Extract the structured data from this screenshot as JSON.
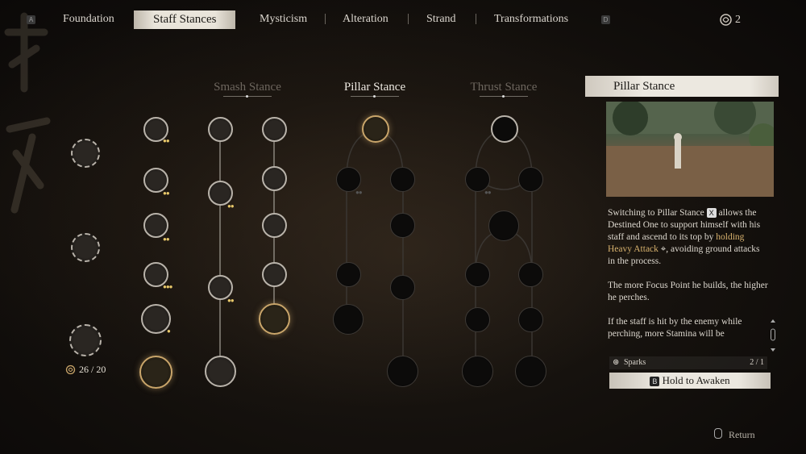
{
  "nav": {
    "left_key": "A",
    "right_key": "D",
    "tabs": [
      "Foundation",
      "Staff Stances",
      "Mysticism",
      "Alteration",
      "Strand",
      "Transformations"
    ],
    "active_tab": "Staff Stances",
    "spark_count": "2"
  },
  "left_column": {
    "progress": "26 / 20"
  },
  "stances": {
    "smash": "Smash Stance",
    "pillar": "Pillar Stance",
    "thrust": "Thrust Stance",
    "selected": "Pillar Stance"
  },
  "panel": {
    "title": "Pillar Stance",
    "desc_1_a": "Switching to Pillar Stance",
    "desc_1_key": "X",
    "desc_1_b": "allows the Destined One to support himself with his staff and ascend to its top by",
    "desc_1_hl": "holding Heavy Attack",
    "desc_1_c": ", avoiding ground attacks in the process.",
    "desc_2": "The more Focus Point he builds, the higher he perches.",
    "desc_3": "If the staff is hit by the enemy while perching, more Stamina will be",
    "sparks_label": "Sparks",
    "sparks_value": "2 / 1",
    "awaken_key": "B",
    "awaken_label": "Hold to Awaken"
  },
  "footer": {
    "return_label": "Return"
  },
  "colors": {
    "accent_gold": "#c9a56a",
    "highlight_text": "#d8b26e",
    "active_tab_bg": "#e9e4da"
  }
}
